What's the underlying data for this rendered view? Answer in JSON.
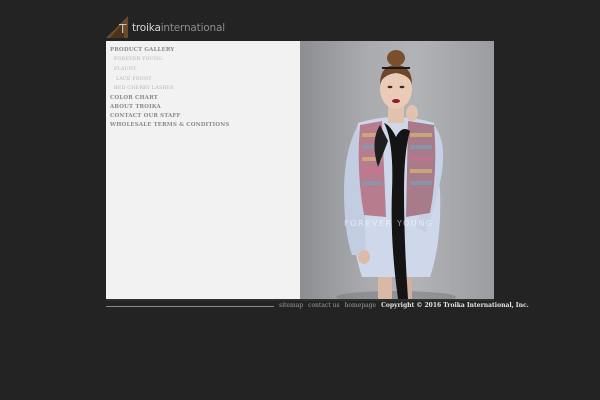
{
  "logo": {
    "mark": "T",
    "text_primary": "troika",
    "text_secondary": "international"
  },
  "nav": {
    "product_gallery": "PRODUCT GALLERY",
    "sub_items": [
      "FOREVER YOUNG",
      "FLAUNT",
      "LACE FRONT",
      "RED CHERRY LASHES"
    ],
    "color_chart": "COLOR CHART",
    "about": "ABOUT TROIKA",
    "contact_staff": "CONTACT OUR STAFF",
    "wholesale": "WHOLESALE TERMS & CONDITIONS"
  },
  "photo": {
    "watermark": "FOREVER YOUNG"
  },
  "footer": {
    "links": [
      "sitemap",
      "contact us",
      "homepage"
    ],
    "copyright": "Copyright © 2016 Troika International, Inc."
  },
  "colors": {
    "page_bg": "#232323",
    "panel_bg": "#f2f2f2",
    "logo_brown": "#6b4a2a"
  }
}
